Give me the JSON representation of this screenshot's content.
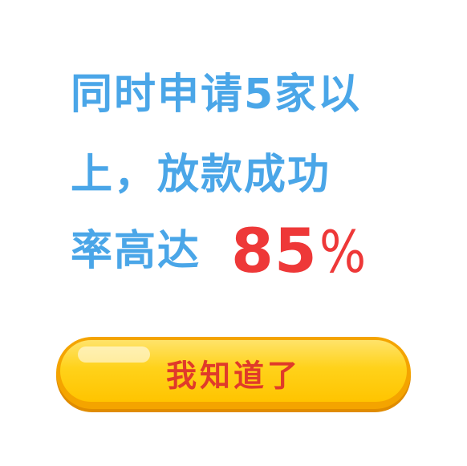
{
  "message": {
    "line1": "同时申请5家以",
    "line2": "上，放款成功",
    "line3_prefix": "率高达",
    "highlight_number": "85",
    "highlight_suffix": "%"
  },
  "confirm_button": {
    "label": "我知道了"
  },
  "colors": {
    "message_text": "#4aa6e8",
    "highlight_text": "#ee3838",
    "button_fill": "#ffd21a",
    "button_border": "#f4a400",
    "button_label": "#e03a2a",
    "background": "#ffffff"
  }
}
